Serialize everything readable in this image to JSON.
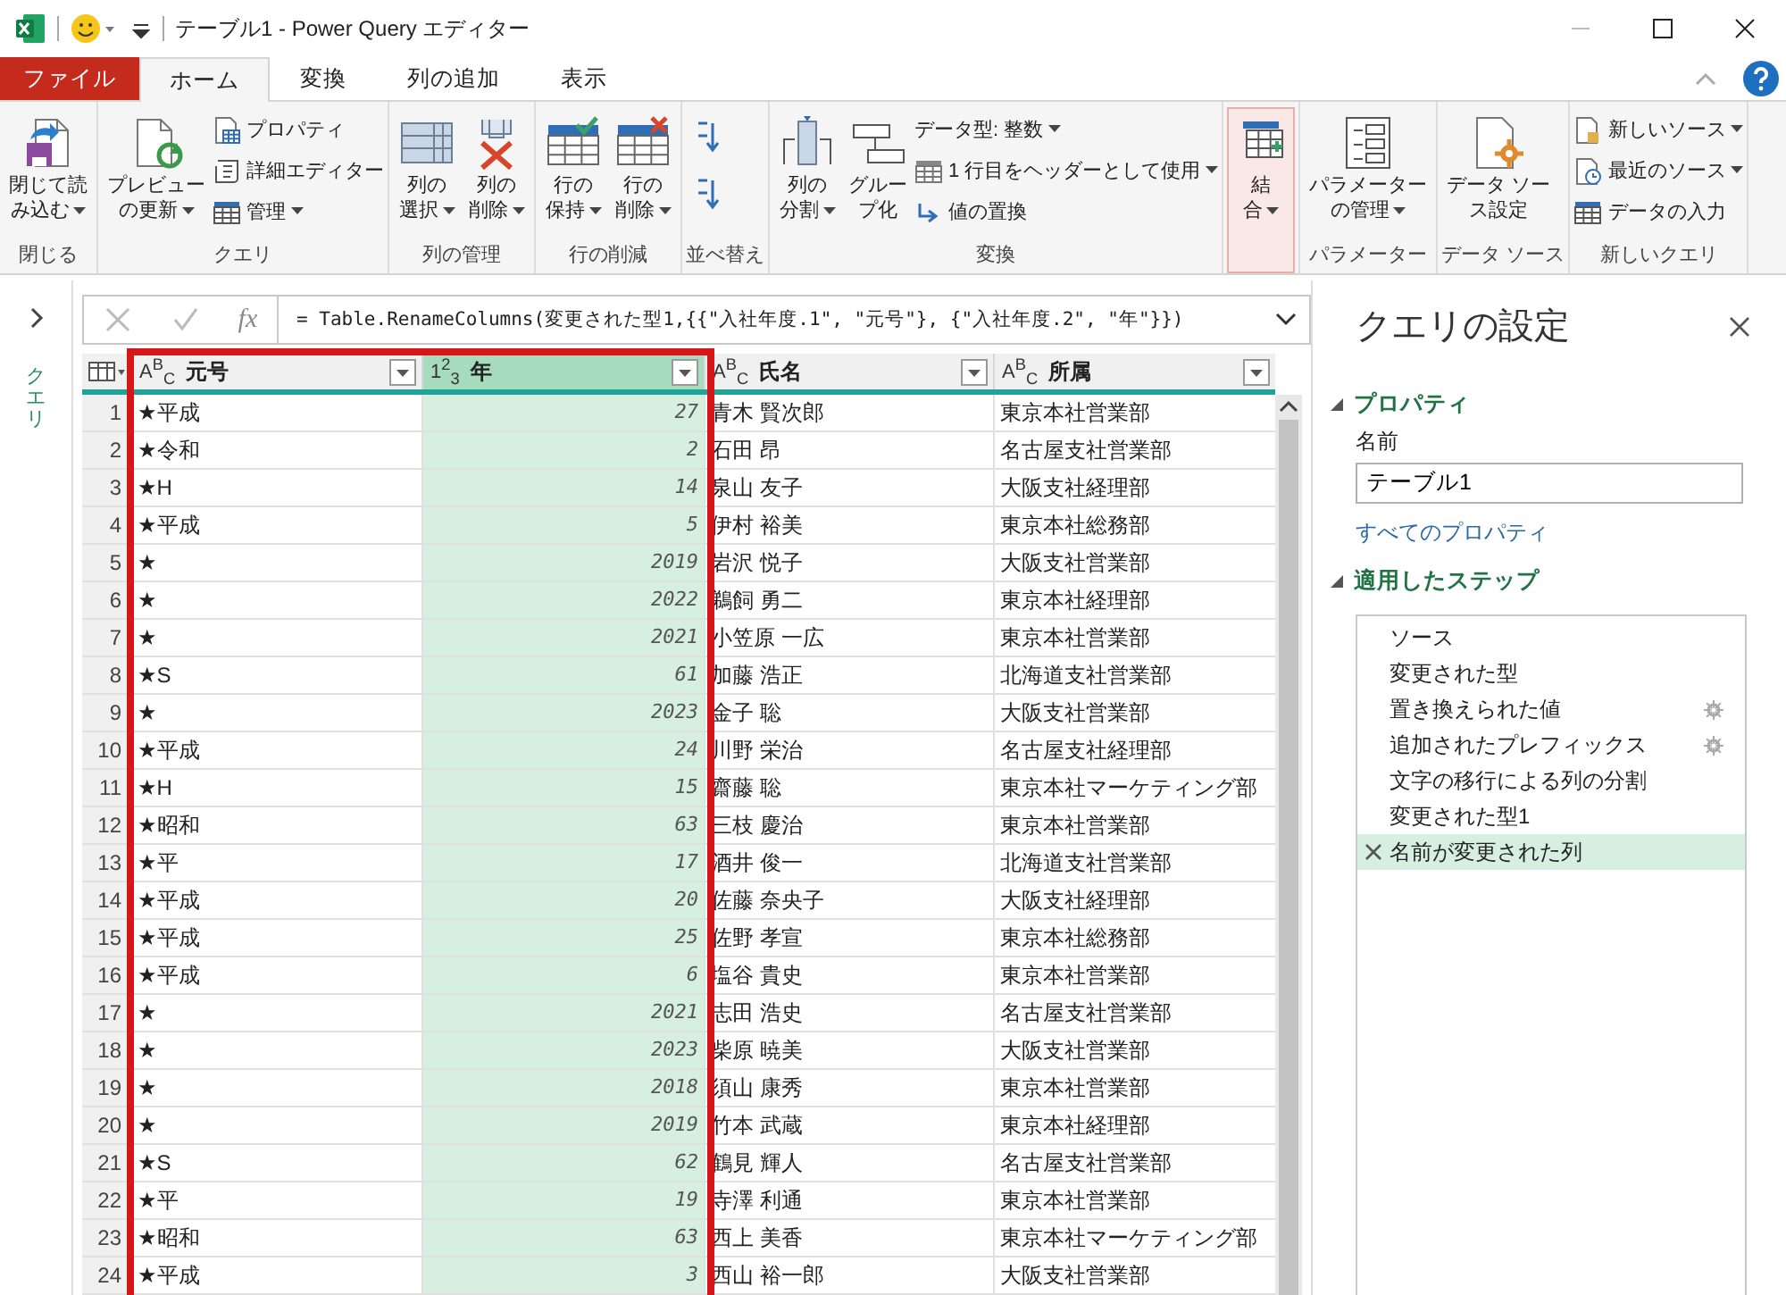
{
  "window": {
    "title": "テーブル1 - Power Query エディター"
  },
  "tabs": [
    {
      "label": "ファイル",
      "kind": "file",
      "selected": false
    },
    {
      "label": "ホーム",
      "kind": "tab",
      "selected": true
    },
    {
      "label": "変換",
      "kind": "tab",
      "selected": false
    },
    {
      "label": "列の追加",
      "kind": "tab",
      "selected": false
    },
    {
      "label": "表示",
      "kind": "tab",
      "selected": false
    }
  ],
  "ribbon": [
    {
      "label": "閉じる",
      "items": [
        {
          "kind": "large",
          "lines": [
            "閉じて読",
            "み込む"
          ],
          "dropdown": true,
          "highlighted": false
        }
      ]
    },
    {
      "label": "クエリ",
      "items": [
        {
          "kind": "large",
          "lines": [
            "プレビュー",
            "の更新"
          ],
          "dropdown": true,
          "highlighted": false
        },
        {
          "kind": "small",
          "label": "プロパティ",
          "dropdown": false
        },
        {
          "kind": "small",
          "label": "詳細エディター",
          "dropdown": false
        },
        {
          "kind": "small",
          "label": "管理",
          "dropdown": true
        }
      ]
    },
    {
      "label": "列の管理",
      "items": [
        {
          "kind": "large",
          "lines": [
            "列の",
            "選択"
          ],
          "dropdown": true,
          "highlighted": false
        },
        {
          "kind": "large",
          "lines": [
            "列の",
            "削除"
          ],
          "dropdown": true,
          "highlighted": false
        }
      ]
    },
    {
      "label": "行の削減",
      "items": [
        {
          "kind": "large",
          "lines": [
            "行の",
            "保持"
          ],
          "dropdown": true,
          "highlighted": false
        },
        {
          "kind": "large",
          "lines": [
            "行の",
            "削除"
          ],
          "dropdown": true,
          "highlighted": false
        }
      ]
    },
    {
      "label": "並べ替え",
      "items": [
        {
          "kind": "icon"
        },
        {
          "kind": "icon"
        }
      ]
    },
    {
      "label": "変換",
      "items": [
        {
          "kind": "large",
          "lines": [
            "列の",
            "分割"
          ],
          "dropdown": true,
          "highlighted": false
        },
        {
          "kind": "large",
          "lines": [
            "グルー",
            "プ化"
          ],
          "dropdown": false,
          "highlighted": false
        },
        {
          "kind": "small",
          "label": "データ型: 整数",
          "dropdown": true
        },
        {
          "kind": "small",
          "label": "1 行目をヘッダーとして使用",
          "dropdown": true
        },
        {
          "kind": "small",
          "label": "値の置換",
          "dropdown": false
        }
      ]
    },
    {
      "items": [
        {
          "kind": "large",
          "lines": [
            "結",
            "合"
          ],
          "dropdown": true,
          "highlighted": true
        }
      ]
    },
    {
      "label": "パラメーター",
      "items": [
        {
          "kind": "large",
          "lines": [
            "パラメーター",
            "の管理"
          ],
          "dropdown": true,
          "highlighted": false
        }
      ]
    },
    {
      "label": "データ ソース",
      "items": [
        {
          "kind": "large",
          "lines": [
            "データ ソー",
            "ス設定"
          ],
          "dropdown": false,
          "highlighted": false
        }
      ]
    },
    {
      "label": "新しいクエリ",
      "items": [
        {
          "kind": "small",
          "label": "新しいソース",
          "dropdown": true
        },
        {
          "kind": "small",
          "label": "最近のソース",
          "dropdown": true
        },
        {
          "kind": "small",
          "label": "データの入力",
          "dropdown": false
        }
      ]
    }
  ],
  "queries_pane": {
    "label": "クエリ"
  },
  "formula_bar": {
    "function_label": "fx",
    "formula": "= Table.RenameColumns(変更された型1,{{\"入社年度.1\", \"元号\"}, {\"入社年度.2\", \"年\"}})"
  },
  "table": {
    "columns": [
      {
        "type_label": "A$^{B}$$_{C}$",
        "name": "元号",
        "kind": "text",
        "selected": false,
        "highlighted": true
      },
      {
        "type_label": "1$^{2}$$_{3}$",
        "name": "年",
        "kind": "number",
        "selected": true,
        "highlighted": true
      },
      {
        "type_label": "A$^{B}$$_{C}$",
        "name": "氏名",
        "kind": "text",
        "selected": false,
        "highlighted": false
      },
      {
        "type_label": "A$^{B}$$_{C}$",
        "name": "所属",
        "kind": "text",
        "selected": false,
        "highlighted": false
      }
    ],
    "rows": [
      {
        "n": "1",
        "cells": [
          "★平成",
          "27",
          "青木 賢次郎",
          "東京本社営業部"
        ]
      },
      {
        "n": "2",
        "cells": [
          "★令和",
          "2",
          "石田 昂",
          "名古屋支社営業部"
        ]
      },
      {
        "n": "3",
        "cells": [
          "★H",
          "14",
          "泉山 友子",
          "大阪支社経理部"
        ]
      },
      {
        "n": "4",
        "cells": [
          "★平成",
          "5",
          "伊村 裕美",
          "東京本社総務部"
        ]
      },
      {
        "n": "5",
        "cells": [
          "★",
          "2019",
          "岩沢 悦子",
          "大阪支社営業部"
        ]
      },
      {
        "n": "6",
        "cells": [
          "★",
          "2022",
          "鵜飼 勇二",
          "東京本社経理部"
        ]
      },
      {
        "n": "7",
        "cells": [
          "★",
          "2021",
          "小笠原 一広",
          "東京本社営業部"
        ]
      },
      {
        "n": "8",
        "cells": [
          "★S",
          "61",
          "加藤 浩正",
          "北海道支社営業部"
        ]
      },
      {
        "n": "9",
        "cells": [
          "★",
          "2023",
          "金子 聡",
          "大阪支社営業部"
        ]
      },
      {
        "n": "10",
        "cells": [
          "★平成",
          "24",
          "川野 栄治",
          "名古屋支社経理部"
        ]
      },
      {
        "n": "11",
        "cells": [
          "★H",
          "15",
          "齋藤 聡",
          "東京本社マーケティング部"
        ]
      },
      {
        "n": "12",
        "cells": [
          "★昭和",
          "63",
          "三枝 慶治",
          "東京本社営業部"
        ]
      },
      {
        "n": "13",
        "cells": [
          "★平",
          "17",
          "酒井 俊一",
          "北海道支社営業部"
        ]
      },
      {
        "n": "14",
        "cells": [
          "★平成",
          "20",
          "佐藤 奈央子",
          "大阪支社経理部"
        ]
      },
      {
        "n": "15",
        "cells": [
          "★平成",
          "25",
          "佐野 孝宣",
          "東京本社総務部"
        ]
      },
      {
        "n": "16",
        "cells": [
          "★平成",
          "6",
          "塩谷 貴史",
          "東京本社営業部"
        ]
      },
      {
        "n": "17",
        "cells": [
          "★",
          "2021",
          "志田 浩史",
          "名古屋支社営業部"
        ]
      },
      {
        "n": "18",
        "cells": [
          "★",
          "2023",
          "柴原 暁美",
          "大阪支社営業部"
        ]
      },
      {
        "n": "19",
        "cells": [
          "★",
          "2018",
          "須山 康秀",
          "東京本社営業部"
        ]
      },
      {
        "n": "20",
        "cells": [
          "★",
          "2019",
          "竹本 武蔵",
          "東京本社経理部"
        ]
      },
      {
        "n": "21",
        "cells": [
          "★S",
          "62",
          "鶴見 輝人",
          "名古屋支社営業部"
        ]
      },
      {
        "n": "22",
        "cells": [
          "★平",
          "19",
          "寺澤 利通",
          "東京本社営業部"
        ]
      },
      {
        "n": "23",
        "cells": [
          "★昭和",
          "63",
          "西上 美香",
          "東京本社マーケティング部"
        ]
      },
      {
        "n": "24",
        "cells": [
          "★平成",
          "3",
          "西山 裕一郎",
          "大阪支社営業部"
        ]
      }
    ]
  },
  "settings": {
    "title": "クエリの設定",
    "properties_heading": "プロパティ",
    "name_label": "名前",
    "name_value": "テーブル1",
    "all_properties_link": "すべてのプロパティ",
    "steps_heading": "適用したステップ",
    "steps": [
      {
        "label": "ソース",
        "settings": false,
        "selected": false
      },
      {
        "label": "変更された型",
        "settings": false,
        "selected": false
      },
      {
        "label": "置き換えられた値",
        "settings": true,
        "selected": false
      },
      {
        "label": "追加されたプレフィックス",
        "settings": true,
        "selected": false
      },
      {
        "label": "文字の移行による列の分割",
        "settings": false,
        "selected": false
      },
      {
        "label": "変更された型1",
        "settings": false,
        "selected": false
      },
      {
        "label": "名前が変更された列",
        "settings": false,
        "selected": true
      }
    ]
  }
}
